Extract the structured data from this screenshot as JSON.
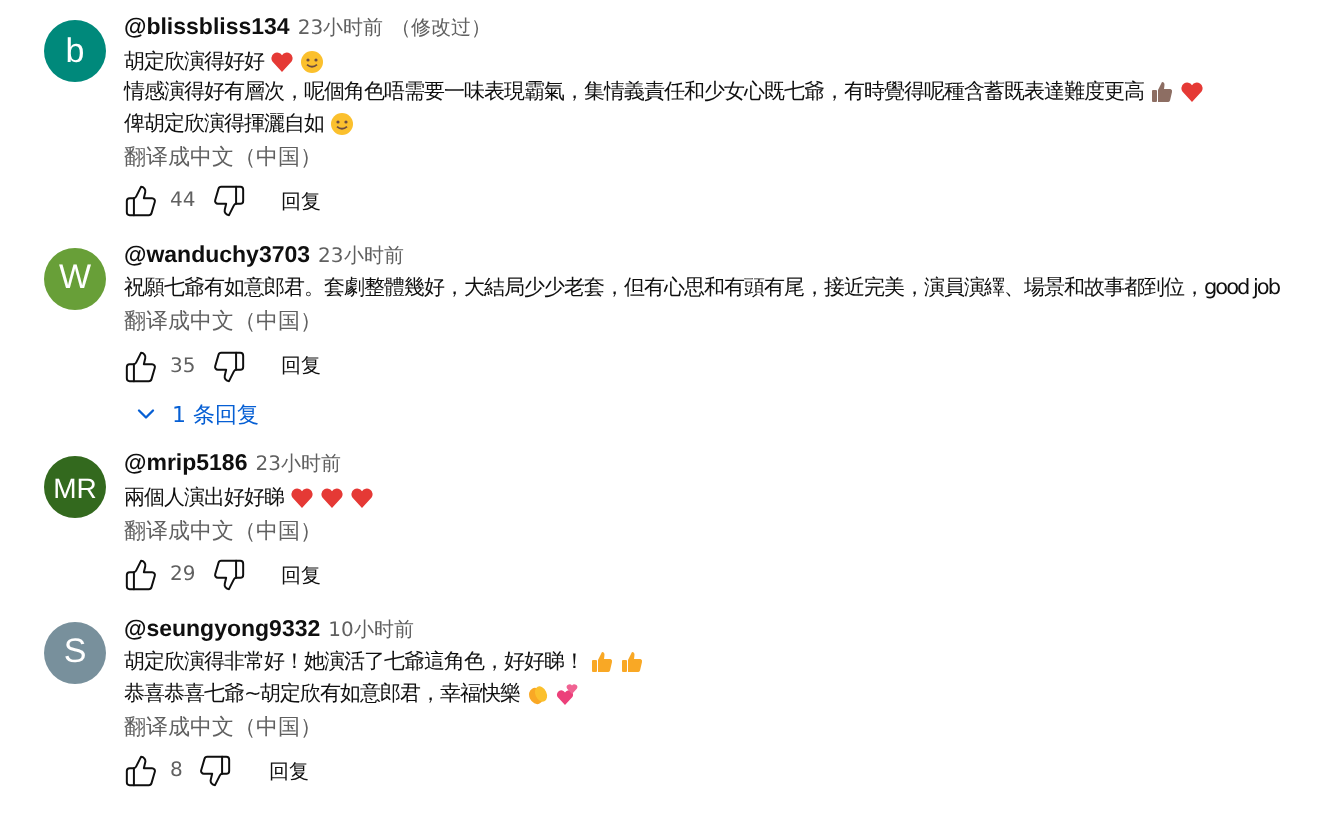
{
  "comments": [
    {
      "avatar": "b",
      "color": "#00897b",
      "username": "@blissbliss134",
      "time": "23小时前",
      "edited": "（修改过）",
      "lines": [
        {
          "text": "胡定欣演得好好",
          "icons": [
            {
              "kind": "heart"
            },
            {
              "kind": "smile"
            }
          ]
        },
        {
          "text": "情感演得好有層次，呢個角色唔需要一味表現霸氣，集情義責任和少女心既七爺，有時覺得呢種含蓄既表達難度更高",
          "icons": [
            {
              "kind": "thumbsdark"
            },
            {
              "kind": "heart"
            }
          ]
        },
        {
          "text": "俾胡定欣演得揮灑自如",
          "icons": [
            {
              "kind": "smile"
            }
          ]
        }
      ],
      "translate": "翻译成中文（中国）",
      "likes": "44",
      "reply": "回复"
    },
    {
      "avatar": "W",
      "color": "#689f38",
      "username": "@wanduchy3703",
      "time": "23小时前",
      "lines": [
        {
          "text": "祝願七爺有如意郎君。套劇整體幾好，大結局少少老套，但有心思和有頭有尾，接近完美，演員演繹、場景和故事都到位，good job"
        }
      ],
      "translate": "翻译成中文（中国）",
      "likes": "35",
      "reply": "回复",
      "replies": "1 条回复"
    },
    {
      "avatar": "MR",
      "color": "#33691e",
      "username": "@mrip5186",
      "time": "23小时前",
      "lines": [
        {
          "text": "兩個人演出好好睇",
          "icons": [
            {
              "kind": "heart"
            },
            {
              "kind": "heart"
            },
            {
              "kind": "heart"
            }
          ]
        }
      ],
      "translate": "翻译成中文（中国）",
      "likes": "29",
      "reply": "回复"
    },
    {
      "avatar": "S",
      "color": "#78909c",
      "username": "@seungyong9332",
      "time": "10小时前",
      "lines": [
        {
          "text": "胡定欣演得非常好！她演活了七爺這角色，好好睇！",
          "icons": [
            {
              "kind": "thumbs"
            },
            {
              "kind": "thumbs"
            }
          ]
        },
        {
          "text": "恭喜恭喜七爺~胡定欣有如意郎君，幸福快樂",
          "icons": [
            {
              "kind": "clap"
            },
            {
              "kind": "hearts"
            }
          ]
        }
      ],
      "translate": "翻译成中文（中国）",
      "likes": "8",
      "reply": "回复"
    }
  ]
}
